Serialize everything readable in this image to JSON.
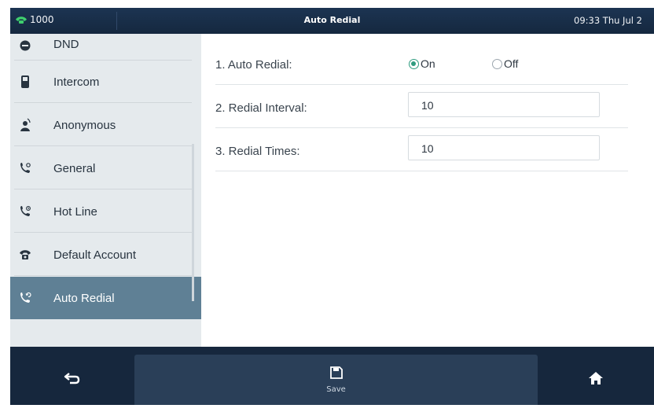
{
  "statusbar": {
    "account": "1000",
    "title": "Auto Redial",
    "clock": "09:33 Thu Jul 2"
  },
  "sidebar": {
    "items": [
      {
        "label": "DND",
        "icon": "dnd-icon",
        "active": false
      },
      {
        "label": "Intercom",
        "icon": "intercom-icon",
        "active": false
      },
      {
        "label": "Anonymous",
        "icon": "anonymous-icon",
        "active": false
      },
      {
        "label": "General",
        "icon": "general-phone-icon",
        "active": false
      },
      {
        "label": "Hot Line",
        "icon": "hotline-icon",
        "active": false
      },
      {
        "label": "Default Account",
        "icon": "telephone-icon",
        "active": false
      },
      {
        "label": "Auto Redial",
        "icon": "auto-redial-icon",
        "active": true
      }
    ]
  },
  "form": {
    "auto_redial": {
      "label": "1. Auto Redial:",
      "on_label": "On",
      "off_label": "Off",
      "selected": "On"
    },
    "redial_interval": {
      "label": "2. Redial Interval:",
      "value": "10"
    },
    "redial_times": {
      "label": "3. Redial Times:",
      "value": "10"
    }
  },
  "softkeys": {
    "back_icon": "back-arrow-icon",
    "save_label": "Save",
    "save_icon": "save-icon",
    "home_icon": "home-icon"
  },
  "colors": {
    "accent": "#2f9c7f",
    "active_sidebar": "#5f8095",
    "chrome": "#16273d"
  }
}
